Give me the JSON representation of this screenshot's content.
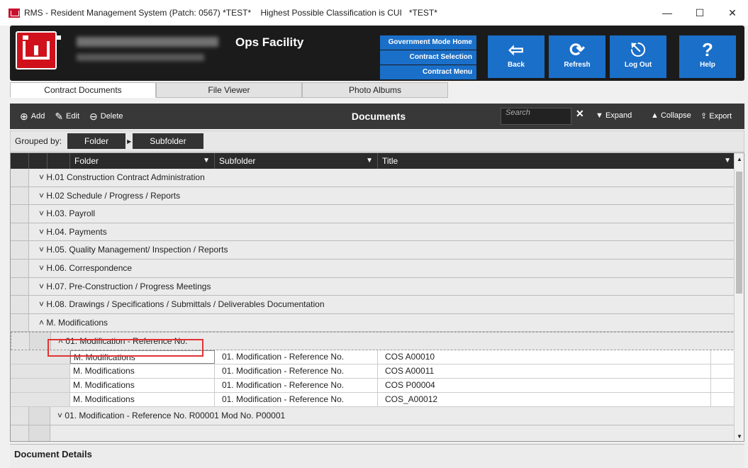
{
  "window": {
    "title": "RMS - Resident Management System (Patch: 0567) *TEST*    Highest Possible Classification is CUI   *TEST*",
    "controls": {
      "minimize": "—",
      "maximize": "☐",
      "close": "✕"
    }
  },
  "header": {
    "site_name": "Ops Facility",
    "mode_links": [
      "Government Mode Home",
      "Contract Selection",
      "Contract Menu"
    ],
    "buttons": [
      {
        "label": "Back",
        "icon": "back-arrow-icon"
      },
      {
        "label": "Refresh",
        "icon": "refresh-icon"
      },
      {
        "label": "Log Out",
        "icon": "logout-icon"
      },
      {
        "label": "Help",
        "icon": "help-icon"
      }
    ],
    "accent_color": "#1a6fc9"
  },
  "tabs": [
    "Contract Documents",
    "File Viewer",
    "Photo Albums"
  ],
  "toolbar": {
    "add": "Add",
    "edit": "Edit",
    "delete": "Delete",
    "title": "Documents",
    "search_placeholder": "Search",
    "expand": "Expand",
    "collapse": "Collapse",
    "export": "Export"
  },
  "grouping": {
    "label": "Grouped by:",
    "chips": [
      "Folder",
      "Subfolder"
    ]
  },
  "grid": {
    "columns": [
      "Folder",
      "Subfolder",
      "Title"
    ],
    "groups": [
      {
        "label": "H.01 Construction Contract Administration",
        "expanded": false
      },
      {
        "label": "H.02 Schedule / Progress / Reports",
        "expanded": false
      },
      {
        "label": "H.03. Payroll",
        "expanded": false
      },
      {
        "label": "H.04. Payments",
        "expanded": false
      },
      {
        "label": "H.05. Quality Management/ Inspection / Reports",
        "expanded": false
      },
      {
        "label": "H.06. Correspondence",
        "expanded": false
      },
      {
        "label": "H.07. Pre-Construction / Progress Meetings",
        "expanded": false
      },
      {
        "label": "H.08. Drawings / Specifications / Submittals / Deliverables Documentation",
        "expanded": false
      },
      {
        "label": "M. Modifications",
        "expanded": true
      }
    ],
    "subgroup": {
      "label": "01. Modification - Reference No.",
      "expanded": true
    },
    "rows": [
      {
        "folder": "M. Modifications",
        "subfolder": "01. Modification - Reference No.",
        "title": "COS A00010"
      },
      {
        "folder": "M. Modifications",
        "subfolder": "01. Modification - Reference No.",
        "title": "COS A00011"
      },
      {
        "folder": "M. Modifications",
        "subfolder": "01. Modification - Reference No.",
        "title": "COS P00004"
      },
      {
        "folder": "M. Modifications",
        "subfolder": "01. Modification - Reference No.",
        "title": "COS_A00012"
      }
    ],
    "next_subgroup": {
      "label": "01. Modification - Reference No. R00001 Mod No. P00001",
      "expanded": false
    }
  },
  "details": {
    "title": "Document Details"
  }
}
